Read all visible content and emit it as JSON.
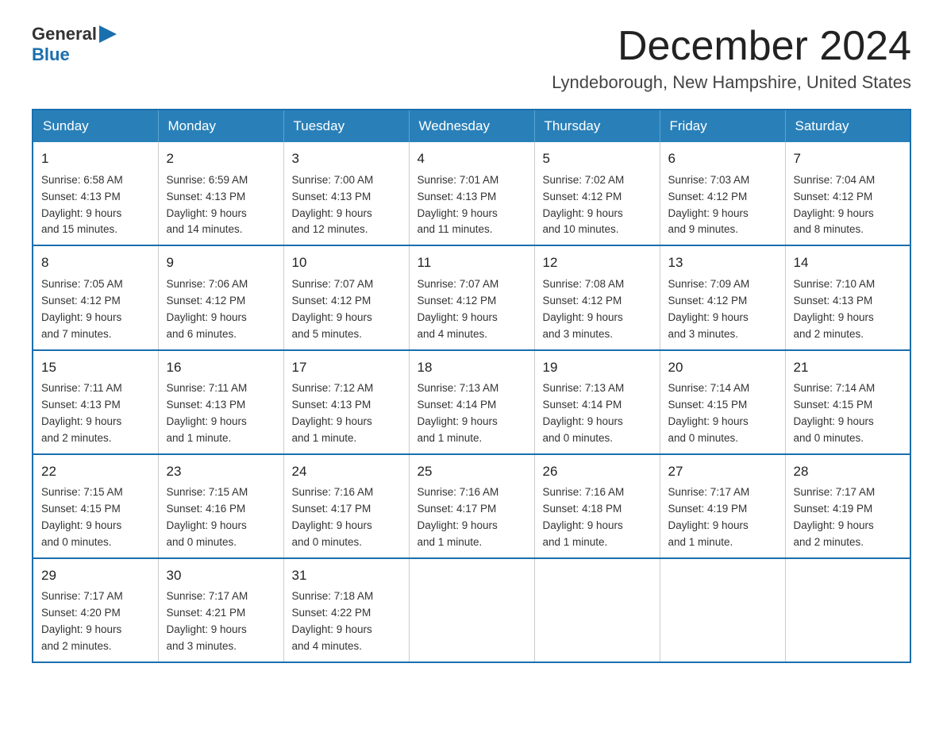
{
  "header": {
    "logo_general": "General",
    "logo_blue": "Blue",
    "month_title": "December 2024",
    "location": "Lyndeborough, New Hampshire, United States"
  },
  "weekdays": [
    "Sunday",
    "Monday",
    "Tuesday",
    "Wednesday",
    "Thursday",
    "Friday",
    "Saturday"
  ],
  "weeks": [
    [
      {
        "day": "1",
        "sunrise": "6:58 AM",
        "sunset": "4:13 PM",
        "daylight": "9 hours and 15 minutes."
      },
      {
        "day": "2",
        "sunrise": "6:59 AM",
        "sunset": "4:13 PM",
        "daylight": "9 hours and 14 minutes."
      },
      {
        "day": "3",
        "sunrise": "7:00 AM",
        "sunset": "4:13 PM",
        "daylight": "9 hours and 12 minutes."
      },
      {
        "day": "4",
        "sunrise": "7:01 AM",
        "sunset": "4:13 PM",
        "daylight": "9 hours and 11 minutes."
      },
      {
        "day": "5",
        "sunrise": "7:02 AM",
        "sunset": "4:12 PM",
        "daylight": "9 hours and 10 minutes."
      },
      {
        "day": "6",
        "sunrise": "7:03 AM",
        "sunset": "4:12 PM",
        "daylight": "9 hours and 9 minutes."
      },
      {
        "day": "7",
        "sunrise": "7:04 AM",
        "sunset": "4:12 PM",
        "daylight": "9 hours and 8 minutes."
      }
    ],
    [
      {
        "day": "8",
        "sunrise": "7:05 AM",
        "sunset": "4:12 PM",
        "daylight": "9 hours and 7 minutes."
      },
      {
        "day": "9",
        "sunrise": "7:06 AM",
        "sunset": "4:12 PM",
        "daylight": "9 hours and 6 minutes."
      },
      {
        "day": "10",
        "sunrise": "7:07 AM",
        "sunset": "4:12 PM",
        "daylight": "9 hours and 5 minutes."
      },
      {
        "day": "11",
        "sunrise": "7:07 AM",
        "sunset": "4:12 PM",
        "daylight": "9 hours and 4 minutes."
      },
      {
        "day": "12",
        "sunrise": "7:08 AM",
        "sunset": "4:12 PM",
        "daylight": "9 hours and 3 minutes."
      },
      {
        "day": "13",
        "sunrise": "7:09 AM",
        "sunset": "4:12 PM",
        "daylight": "9 hours and 3 minutes."
      },
      {
        "day": "14",
        "sunrise": "7:10 AM",
        "sunset": "4:13 PM",
        "daylight": "9 hours and 2 minutes."
      }
    ],
    [
      {
        "day": "15",
        "sunrise": "7:11 AM",
        "sunset": "4:13 PM",
        "daylight": "9 hours and 2 minutes."
      },
      {
        "day": "16",
        "sunrise": "7:11 AM",
        "sunset": "4:13 PM",
        "daylight": "9 hours and 1 minute."
      },
      {
        "day": "17",
        "sunrise": "7:12 AM",
        "sunset": "4:13 PM",
        "daylight": "9 hours and 1 minute."
      },
      {
        "day": "18",
        "sunrise": "7:13 AM",
        "sunset": "4:14 PM",
        "daylight": "9 hours and 1 minute."
      },
      {
        "day": "19",
        "sunrise": "7:13 AM",
        "sunset": "4:14 PM",
        "daylight": "9 hours and 0 minutes."
      },
      {
        "day": "20",
        "sunrise": "7:14 AM",
        "sunset": "4:15 PM",
        "daylight": "9 hours and 0 minutes."
      },
      {
        "day": "21",
        "sunrise": "7:14 AM",
        "sunset": "4:15 PM",
        "daylight": "9 hours and 0 minutes."
      }
    ],
    [
      {
        "day": "22",
        "sunrise": "7:15 AM",
        "sunset": "4:15 PM",
        "daylight": "9 hours and 0 minutes."
      },
      {
        "day": "23",
        "sunrise": "7:15 AM",
        "sunset": "4:16 PM",
        "daylight": "9 hours and 0 minutes."
      },
      {
        "day": "24",
        "sunrise": "7:16 AM",
        "sunset": "4:17 PM",
        "daylight": "9 hours and 0 minutes."
      },
      {
        "day": "25",
        "sunrise": "7:16 AM",
        "sunset": "4:17 PM",
        "daylight": "9 hours and 1 minute."
      },
      {
        "day": "26",
        "sunrise": "7:16 AM",
        "sunset": "4:18 PM",
        "daylight": "9 hours and 1 minute."
      },
      {
        "day": "27",
        "sunrise": "7:17 AM",
        "sunset": "4:19 PM",
        "daylight": "9 hours and 1 minute."
      },
      {
        "day": "28",
        "sunrise": "7:17 AM",
        "sunset": "4:19 PM",
        "daylight": "9 hours and 2 minutes."
      }
    ],
    [
      {
        "day": "29",
        "sunrise": "7:17 AM",
        "sunset": "4:20 PM",
        "daylight": "9 hours and 2 minutes."
      },
      {
        "day": "30",
        "sunrise": "7:17 AM",
        "sunset": "4:21 PM",
        "daylight": "9 hours and 3 minutes."
      },
      {
        "day": "31",
        "sunrise": "7:18 AM",
        "sunset": "4:22 PM",
        "daylight": "9 hours and 4 minutes."
      },
      null,
      null,
      null,
      null
    ]
  ],
  "labels": {
    "sunrise": "Sunrise:",
    "sunset": "Sunset:",
    "daylight": "Daylight:"
  }
}
